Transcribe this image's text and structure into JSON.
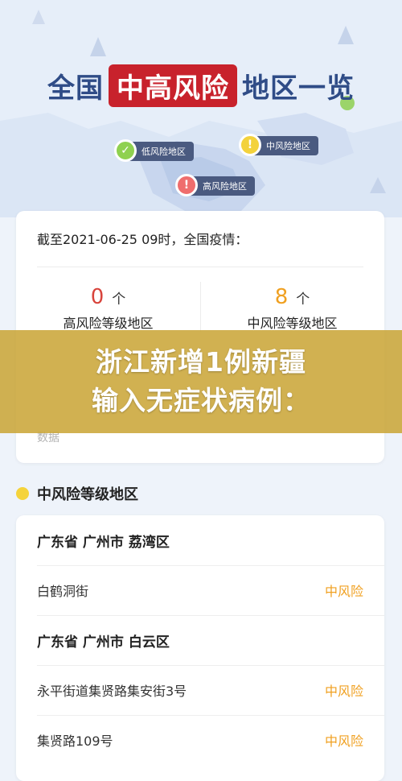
{
  "header": {
    "title_prefix": "全国",
    "title_highlight": "中高风险",
    "title_suffix": "地区一览",
    "legend": {
      "low": "低风险地区",
      "mid": "中风险地区",
      "high": "高风险地区",
      "mid_mark": "!",
      "high_mark": "!"
    }
  },
  "stats": {
    "as_of": "截至2021-06-25 09时，全国疫情：",
    "high": {
      "count": "0",
      "unit": "个",
      "label": "高风险等级地区"
    },
    "mid": {
      "count": "8",
      "unit": "个",
      "label": "中风险等级地区"
    },
    "note": "数据"
  },
  "banner": {
    "line1": "浙江新增1例新疆",
    "line2": "输入无症状病例："
  },
  "mid_section": {
    "title": "中风险等级地区",
    "rows": [
      {
        "label": "广东省 广州市 荔湾区"
      },
      {
        "label": "白鹤洞街",
        "level": "中风险"
      },
      {
        "label": "广东省 广州市 白云区"
      },
      {
        "label": "永平街道集贤路集安街3号",
        "level": "中风险"
      },
      {
        "label": "集贤路109号",
        "level": "中风险"
      }
    ]
  },
  "colors": {
    "title_blue": "#2f4c87",
    "title_red": "#c8222c",
    "high_red": "#d8443c",
    "mid_orange": "#f0a020",
    "banner_gold": "#caa434"
  }
}
